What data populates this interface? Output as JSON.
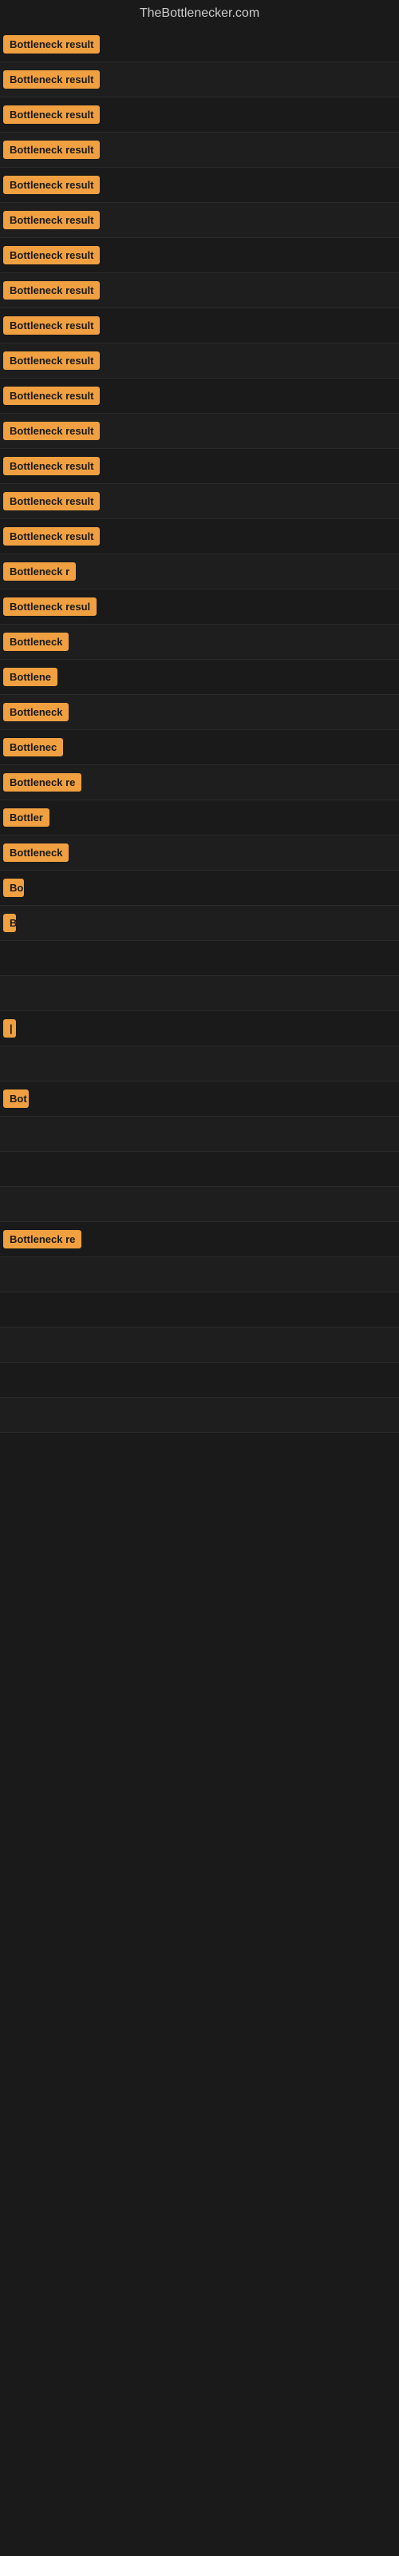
{
  "site": {
    "title": "TheBottlenecker.com"
  },
  "badge_color": "#f0a040",
  "rows": [
    {
      "id": 1,
      "label": "Bottleneck result",
      "width": 160
    },
    {
      "id": 2,
      "label": "Bottleneck result",
      "width": 160
    },
    {
      "id": 3,
      "label": "Bottleneck result",
      "width": 160
    },
    {
      "id": 4,
      "label": "Bottleneck result",
      "width": 160
    },
    {
      "id": 5,
      "label": "Bottleneck result",
      "width": 160
    },
    {
      "id": 6,
      "label": "Bottleneck result",
      "width": 160
    },
    {
      "id": 7,
      "label": "Bottleneck result",
      "width": 160
    },
    {
      "id": 8,
      "label": "Bottleneck result",
      "width": 160
    },
    {
      "id": 9,
      "label": "Bottleneck result",
      "width": 160
    },
    {
      "id": 10,
      "label": "Bottleneck result",
      "width": 160
    },
    {
      "id": 11,
      "label": "Bottleneck result",
      "width": 160
    },
    {
      "id": 12,
      "label": "Bottleneck result",
      "width": 160
    },
    {
      "id": 13,
      "label": "Bottleneck result",
      "width": 160
    },
    {
      "id": 14,
      "label": "Bottleneck result",
      "width": 160
    },
    {
      "id": 15,
      "label": "Bottleneck result",
      "width": 155
    },
    {
      "id": 16,
      "label": "Bottleneck r",
      "width": 110
    },
    {
      "id": 17,
      "label": "Bottleneck resul",
      "width": 130
    },
    {
      "id": 18,
      "label": "Bottleneck",
      "width": 90
    },
    {
      "id": 19,
      "label": "Bottlene",
      "width": 72
    },
    {
      "id": 20,
      "label": "Bottleneck",
      "width": 90
    },
    {
      "id": 21,
      "label": "Bottlenec",
      "width": 80
    },
    {
      "id": 22,
      "label": "Bottleneck re",
      "width": 118
    },
    {
      "id": 23,
      "label": "Bottler",
      "width": 58
    },
    {
      "id": 24,
      "label": "Bottleneck",
      "width": 90
    },
    {
      "id": 25,
      "label": "Bo",
      "width": 26
    },
    {
      "id": 26,
      "label": "B",
      "width": 14
    },
    {
      "id": 27,
      "label": "",
      "width": 0
    },
    {
      "id": 28,
      "label": "",
      "width": 0
    },
    {
      "id": 29,
      "label": "|",
      "width": 6
    },
    {
      "id": 30,
      "label": "",
      "width": 0
    },
    {
      "id": 31,
      "label": "Bot",
      "width": 32
    },
    {
      "id": 32,
      "label": "",
      "width": 0
    },
    {
      "id": 33,
      "label": "",
      "width": 0
    },
    {
      "id": 34,
      "label": "",
      "width": 0
    },
    {
      "id": 35,
      "label": "Bottleneck re",
      "width": 118
    },
    {
      "id": 36,
      "label": "",
      "width": 0
    },
    {
      "id": 37,
      "label": "",
      "width": 0
    },
    {
      "id": 38,
      "label": "",
      "width": 0
    },
    {
      "id": 39,
      "label": "",
      "width": 0
    },
    {
      "id": 40,
      "label": "",
      "width": 0
    }
  ]
}
